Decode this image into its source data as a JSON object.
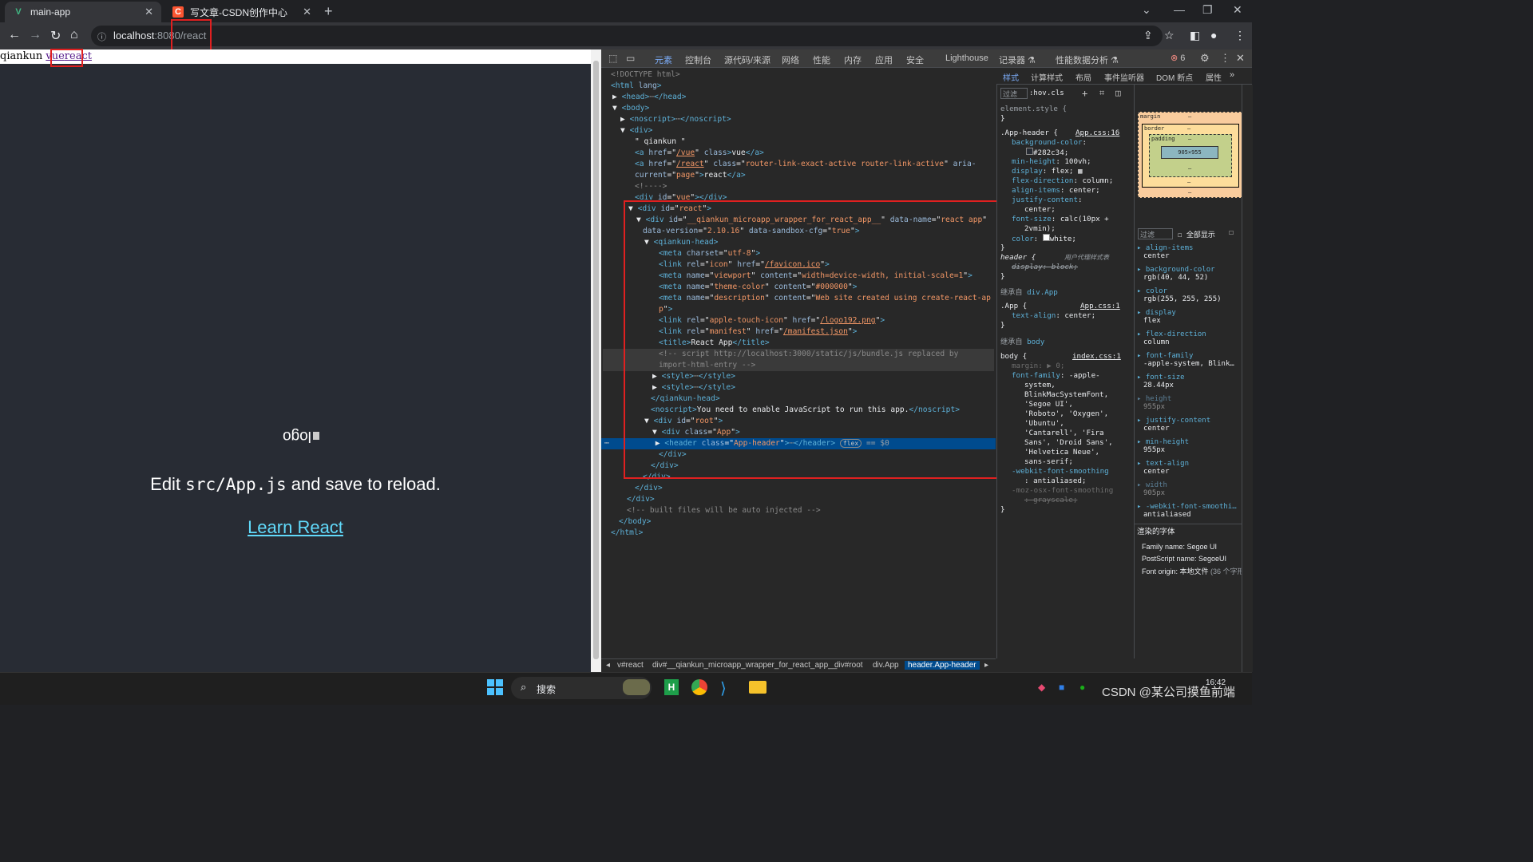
{
  "browser": {
    "tabs": [
      {
        "title": "main-app",
        "icon": "vue-icon",
        "icon_char": "V",
        "icon_color": "#41b883",
        "active": true
      },
      {
        "title": "写文章-CSDN创作中心",
        "icon": "csdn-icon",
        "icon_char": "C",
        "icon_color": "#fc5531",
        "active": false
      }
    ],
    "new_tab_label": "+",
    "url_host": "localhost",
    "url_rest": ":8080/react"
  },
  "page": {
    "nav_text": "qiankun ",
    "nav_links": [
      "vue",
      "react"
    ],
    "logo_text": "logo",
    "edit_prefix": "Edit ",
    "edit_code": "src/App.js",
    "edit_suffix": " and save to reload.",
    "learn_link": "Learn React"
  },
  "devtools": {
    "tabs": [
      "元素",
      "控制台",
      "源代码/来源",
      "网络",
      "性能",
      "内存",
      "应用",
      "安全",
      "Lighthouse",
      "记录器 ⚗",
      "性能数据分析 ⚗"
    ],
    "error_count": "6",
    "style_tabs": [
      "样式",
      "计算样式",
      "布局",
      "事件监听器",
      "DOM 断点",
      "属性"
    ],
    "filter_placeholder": "过滤",
    "hov": ":hov",
    "cls": ".cls",
    "computed_filter": "过滤",
    "show_all": "全部显示",
    "box_model": {
      "margin": "margin",
      "border": "border",
      "padding": "padding",
      "content": "905×955",
      "dash": "–"
    },
    "computed": [
      {
        "prop": "align-items",
        "val": "center"
      },
      {
        "prop": "background-color",
        "val": "rgb(40, 44, 52)"
      },
      {
        "prop": "color",
        "val": "rgb(255, 255, 255)"
      },
      {
        "prop": "display",
        "val": "flex"
      },
      {
        "prop": "flex-direction",
        "val": "column"
      },
      {
        "prop": "font-family",
        "val": "-apple-system, Blink…"
      },
      {
        "prop": "font-size",
        "val": "28.44px"
      },
      {
        "prop": "height",
        "val": "955px"
      },
      {
        "prop": "justify-content",
        "val": "center"
      },
      {
        "prop": "min-height",
        "val": "955px"
      },
      {
        "prop": "text-align",
        "val": "center"
      },
      {
        "prop": "width",
        "val": "905px"
      },
      {
        "prop": "-webkit-font-smoothi…",
        "val": "antialiased"
      }
    ],
    "rendered_fonts_title": "渲染的字体",
    "font_family": "Family name: Segoe UI",
    "font_postscript": "PostScript name: SegoeUI",
    "font_origin": "Font origin: 本地文件",
    "font_origin_note": "(36 个字形)",
    "breadcrumbs": [
      "v#react",
      "div#__qiankun_microapp_wrapper_for_react_app__",
      "div#root",
      "div.App",
      "header.App-header"
    ]
  },
  "taskbar": {
    "search_label": "搜索",
    "time": "16:42",
    "watermark": "CSDN @某公司摸鱼前端"
  }
}
